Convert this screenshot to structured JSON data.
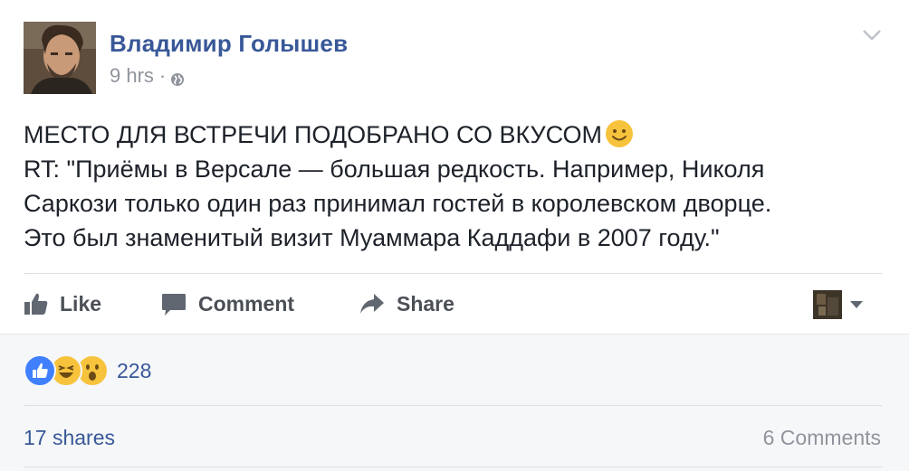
{
  "post": {
    "author": "Владимир Голышев",
    "time": "9 hrs",
    "separator": "·",
    "privacy_icon": "globe-icon",
    "menu_icon": "chevron-down-icon",
    "text_lines": [
      "МЕСТО ДЛЯ ВСТРЕЧИ ПОДОБРАНО СО ВКУСОМ",
      "RT: \"Приёмы в Версале — большая редкость. Например, Николя",
      "Саркози только один раз принимал гостей в королевском дворце.",
      "Это был знаменитый визит Муаммара Каддафи в 2007 году.\""
    ],
    "emoji": "smile-icon"
  },
  "actions": {
    "like_label": "Like",
    "comment_label": "Comment",
    "share_label": "Share"
  },
  "footer": {
    "reactions": [
      "like",
      "haha",
      "wow"
    ],
    "reaction_count": "228",
    "shares": "17 shares",
    "comments": "6 Comments"
  },
  "colors": {
    "link_blue": "#385898",
    "text": "#1d2129",
    "muted": "#90949c",
    "action": "#4b4f56",
    "footer_bg": "#f6f7f9",
    "like_blue": "#4080ff",
    "emoji_yellow": "#f7c33c"
  }
}
